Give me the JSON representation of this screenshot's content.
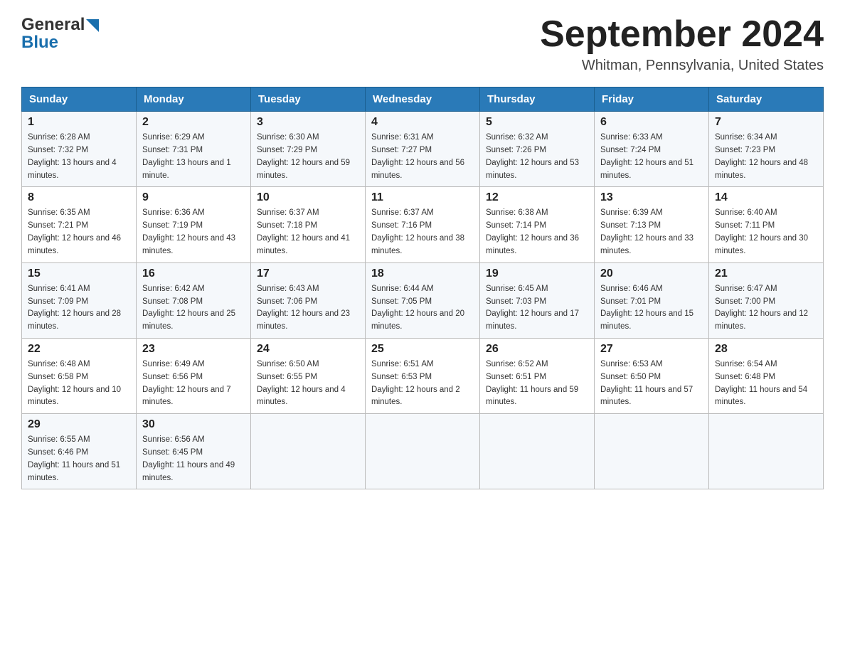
{
  "header": {
    "logo_line1": "General",
    "logo_line2": "Blue",
    "title": "September 2024",
    "subtitle": "Whitman, Pennsylvania, United States"
  },
  "days_of_week": [
    "Sunday",
    "Monday",
    "Tuesday",
    "Wednesday",
    "Thursday",
    "Friday",
    "Saturday"
  ],
  "weeks": [
    [
      {
        "day": "1",
        "sunrise": "6:28 AM",
        "sunset": "7:32 PM",
        "daylight": "13 hours and 4 minutes."
      },
      {
        "day": "2",
        "sunrise": "6:29 AM",
        "sunset": "7:31 PM",
        "daylight": "13 hours and 1 minute."
      },
      {
        "day": "3",
        "sunrise": "6:30 AM",
        "sunset": "7:29 PM",
        "daylight": "12 hours and 59 minutes."
      },
      {
        "day": "4",
        "sunrise": "6:31 AM",
        "sunset": "7:27 PM",
        "daylight": "12 hours and 56 minutes."
      },
      {
        "day": "5",
        "sunrise": "6:32 AM",
        "sunset": "7:26 PM",
        "daylight": "12 hours and 53 minutes."
      },
      {
        "day": "6",
        "sunrise": "6:33 AM",
        "sunset": "7:24 PM",
        "daylight": "12 hours and 51 minutes."
      },
      {
        "day": "7",
        "sunrise": "6:34 AM",
        "sunset": "7:23 PM",
        "daylight": "12 hours and 48 minutes."
      }
    ],
    [
      {
        "day": "8",
        "sunrise": "6:35 AM",
        "sunset": "7:21 PM",
        "daylight": "12 hours and 46 minutes."
      },
      {
        "day": "9",
        "sunrise": "6:36 AM",
        "sunset": "7:19 PM",
        "daylight": "12 hours and 43 minutes."
      },
      {
        "day": "10",
        "sunrise": "6:37 AM",
        "sunset": "7:18 PM",
        "daylight": "12 hours and 41 minutes."
      },
      {
        "day": "11",
        "sunrise": "6:37 AM",
        "sunset": "7:16 PM",
        "daylight": "12 hours and 38 minutes."
      },
      {
        "day": "12",
        "sunrise": "6:38 AM",
        "sunset": "7:14 PM",
        "daylight": "12 hours and 36 minutes."
      },
      {
        "day": "13",
        "sunrise": "6:39 AM",
        "sunset": "7:13 PM",
        "daylight": "12 hours and 33 minutes."
      },
      {
        "day": "14",
        "sunrise": "6:40 AM",
        "sunset": "7:11 PM",
        "daylight": "12 hours and 30 minutes."
      }
    ],
    [
      {
        "day": "15",
        "sunrise": "6:41 AM",
        "sunset": "7:09 PM",
        "daylight": "12 hours and 28 minutes."
      },
      {
        "day": "16",
        "sunrise": "6:42 AM",
        "sunset": "7:08 PM",
        "daylight": "12 hours and 25 minutes."
      },
      {
        "day": "17",
        "sunrise": "6:43 AM",
        "sunset": "7:06 PM",
        "daylight": "12 hours and 23 minutes."
      },
      {
        "day": "18",
        "sunrise": "6:44 AM",
        "sunset": "7:05 PM",
        "daylight": "12 hours and 20 minutes."
      },
      {
        "day": "19",
        "sunrise": "6:45 AM",
        "sunset": "7:03 PM",
        "daylight": "12 hours and 17 minutes."
      },
      {
        "day": "20",
        "sunrise": "6:46 AM",
        "sunset": "7:01 PM",
        "daylight": "12 hours and 15 minutes."
      },
      {
        "day": "21",
        "sunrise": "6:47 AM",
        "sunset": "7:00 PM",
        "daylight": "12 hours and 12 minutes."
      }
    ],
    [
      {
        "day": "22",
        "sunrise": "6:48 AM",
        "sunset": "6:58 PM",
        "daylight": "12 hours and 10 minutes."
      },
      {
        "day": "23",
        "sunrise": "6:49 AM",
        "sunset": "6:56 PM",
        "daylight": "12 hours and 7 minutes."
      },
      {
        "day": "24",
        "sunrise": "6:50 AM",
        "sunset": "6:55 PM",
        "daylight": "12 hours and 4 minutes."
      },
      {
        "day": "25",
        "sunrise": "6:51 AM",
        "sunset": "6:53 PM",
        "daylight": "12 hours and 2 minutes."
      },
      {
        "day": "26",
        "sunrise": "6:52 AM",
        "sunset": "6:51 PM",
        "daylight": "11 hours and 59 minutes."
      },
      {
        "day": "27",
        "sunrise": "6:53 AM",
        "sunset": "6:50 PM",
        "daylight": "11 hours and 57 minutes."
      },
      {
        "day": "28",
        "sunrise": "6:54 AM",
        "sunset": "6:48 PM",
        "daylight": "11 hours and 54 minutes."
      }
    ],
    [
      {
        "day": "29",
        "sunrise": "6:55 AM",
        "sunset": "6:46 PM",
        "daylight": "11 hours and 51 minutes."
      },
      {
        "day": "30",
        "sunrise": "6:56 AM",
        "sunset": "6:45 PM",
        "daylight": "11 hours and 49 minutes."
      },
      null,
      null,
      null,
      null,
      null
    ]
  ]
}
